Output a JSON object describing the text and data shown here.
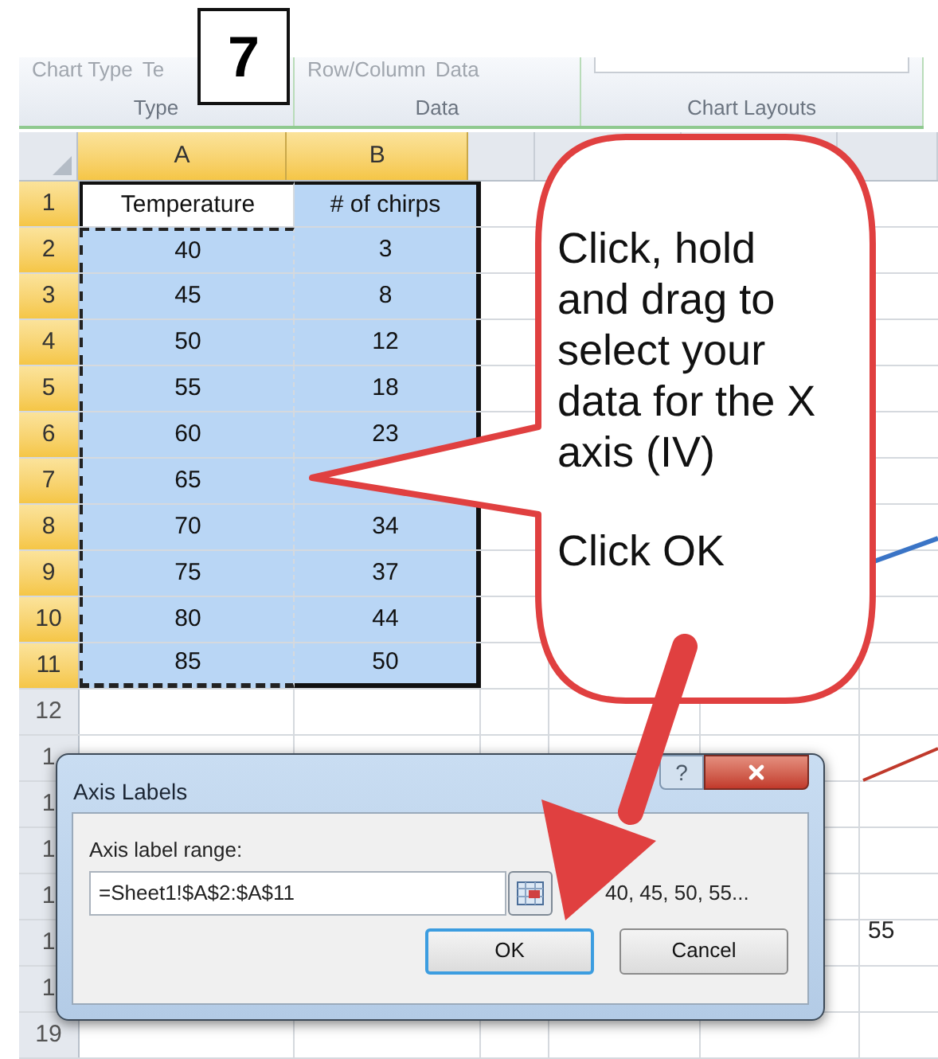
{
  "step_badge": "7",
  "ribbon": {
    "groups": [
      {
        "label": "Type",
        "commands": [
          "Chart Type",
          "Te"
        ]
      },
      {
        "label": "Data",
        "commands": [
          "Row/Column",
          "Data"
        ]
      },
      {
        "label": "Chart Layouts"
      }
    ]
  },
  "sheet": {
    "columns": [
      {
        "label": "A",
        "selected": true
      },
      {
        "label": "B",
        "selected": true
      }
    ],
    "rows": [
      {
        "label": "1",
        "selected": true,
        "cells": [
          {
            "text": "Temperature",
            "selected": false,
            "referenced": false
          },
          {
            "text": "# of chirps",
            "selected": true,
            "referenced": false
          }
        ]
      },
      {
        "label": "2",
        "selected": true,
        "cells": [
          {
            "text": "40",
            "selected": true,
            "referenced": true
          },
          {
            "text": "3",
            "selected": true,
            "referenced": false
          }
        ]
      },
      {
        "label": "3",
        "selected": true,
        "cells": [
          {
            "text": "45",
            "selected": true,
            "referenced": true
          },
          {
            "text": "8",
            "selected": true,
            "referenced": false
          }
        ]
      },
      {
        "label": "4",
        "selected": true,
        "cells": [
          {
            "text": "50",
            "selected": true,
            "referenced": true
          },
          {
            "text": "12",
            "selected": true,
            "referenced": false
          }
        ]
      },
      {
        "label": "5",
        "selected": true,
        "cells": [
          {
            "text": "55",
            "selected": true,
            "referenced": true
          },
          {
            "text": "18",
            "selected": true,
            "referenced": false
          }
        ]
      },
      {
        "label": "6",
        "selected": true,
        "cells": [
          {
            "text": "60",
            "selected": true,
            "referenced": true
          },
          {
            "text": "23",
            "selected": true,
            "referenced": false
          }
        ]
      },
      {
        "label": "7",
        "selected": true,
        "cells": [
          {
            "text": "65",
            "selected": true,
            "referenced": true
          },
          {
            "selected": true,
            "referenced": false
          }
        ]
      },
      {
        "label": "8",
        "selected": true,
        "cells": [
          {
            "text": "70",
            "selected": true,
            "referenced": true
          },
          {
            "text": "34",
            "selected": true,
            "referenced": false
          }
        ]
      },
      {
        "label": "9",
        "selected": true,
        "cells": [
          {
            "text": "75",
            "selected": true,
            "referenced": true
          },
          {
            "text": "37",
            "selected": true,
            "referenced": false
          }
        ]
      },
      {
        "label": "10",
        "selected": true,
        "cells": [
          {
            "text": "80",
            "selected": true,
            "referenced": true
          },
          {
            "text": "44",
            "selected": true,
            "referenced": false
          }
        ]
      },
      {
        "label": "11",
        "selected": true,
        "cells": [
          {
            "text": "85",
            "selected": true,
            "referenced": true
          },
          {
            "text": "50",
            "selected": true,
            "referenced": false
          }
        ]
      },
      {
        "label": "12",
        "selected": false
      },
      {
        "label": "1",
        "selected": false
      },
      {
        "label": "1",
        "selected": false
      },
      {
        "label": "1",
        "selected": false
      },
      {
        "label": "1",
        "selected": false
      },
      {
        "label": "1",
        "selected": false
      },
      {
        "label": "1",
        "selected": false
      },
      {
        "label": "19",
        "selected": false
      }
    ]
  },
  "chart": {
    "axis_label": "55"
  },
  "callout": {
    "text": "Click, hold and drag to select your data for the X axis (IV)",
    "note": "Click OK"
  },
  "dialog": {
    "title": "Axis Labels",
    "help": "?",
    "field_label": "Axis label range:",
    "value": "=Sheet1!$A$2:$A$11",
    "preview": "40, 45, 50, 55...",
    "buttons": [
      {
        "label": "OK",
        "focused": true
      },
      {
        "label": "Cancel",
        "focused": false
      }
    ]
  }
}
